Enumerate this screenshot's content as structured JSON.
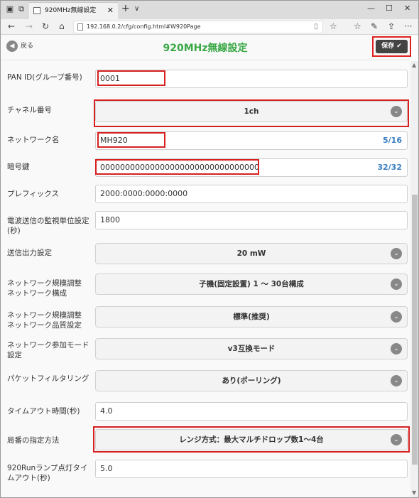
{
  "browser": {
    "tab_title": "920MHz無線設定",
    "url": "192.168.0.2/cfg/config.html#W920Page"
  },
  "header": {
    "back_label": "戻る",
    "title": "920MHz無線設定",
    "save_label": "保存 ✔"
  },
  "fields": [
    {
      "label": "PAN ID(グループ番号)",
      "type": "input",
      "value": "0001"
    },
    {
      "label": "チャネル番号",
      "type": "select",
      "value": "1ch"
    },
    {
      "label": "ネットワーク名",
      "type": "input",
      "value": "MH920",
      "counter": "5/16"
    },
    {
      "label": "暗号鍵",
      "type": "input",
      "value": "00000000000000000000000000000000",
      "counter": "32/32"
    },
    {
      "label": "プレフィックス",
      "type": "input",
      "value": "2000:0000:0000:0000"
    },
    {
      "label": "電波送信の監視単位設定(秒)",
      "type": "input",
      "value": "1800"
    },
    {
      "label": "送信出力設定",
      "type": "select",
      "value": "20 mW"
    },
    {
      "label": "ネットワーク規模調整 ネットワーク構成",
      "type": "select",
      "value": "子機(固定設置) 1 ～ 30台構成"
    },
    {
      "label": "ネットワーク規模調整 ネットワーク品質設定",
      "type": "select",
      "value": "標準(推奨)"
    },
    {
      "label": "ネットワーク参加モード設定",
      "type": "select",
      "value": "v3互換モード"
    },
    {
      "label": "パケットフィルタリング",
      "type": "select",
      "value": "あり(ポーリング)"
    },
    {
      "label": "タイムアウト時間(秒)",
      "type": "input",
      "value": "4.0"
    },
    {
      "label": "局番の指定方法",
      "type": "select",
      "value": "レンジ方式：最大マルチドロップ数1～4台"
    },
    {
      "label": "920Runランプ点灯タイムアウト(秒)",
      "type": "input",
      "value": "5.0"
    }
  ],
  "colors": {
    "title_green": "#39a845",
    "counter_blue": "#3a7fc2",
    "highlight_red": "#d62020"
  }
}
